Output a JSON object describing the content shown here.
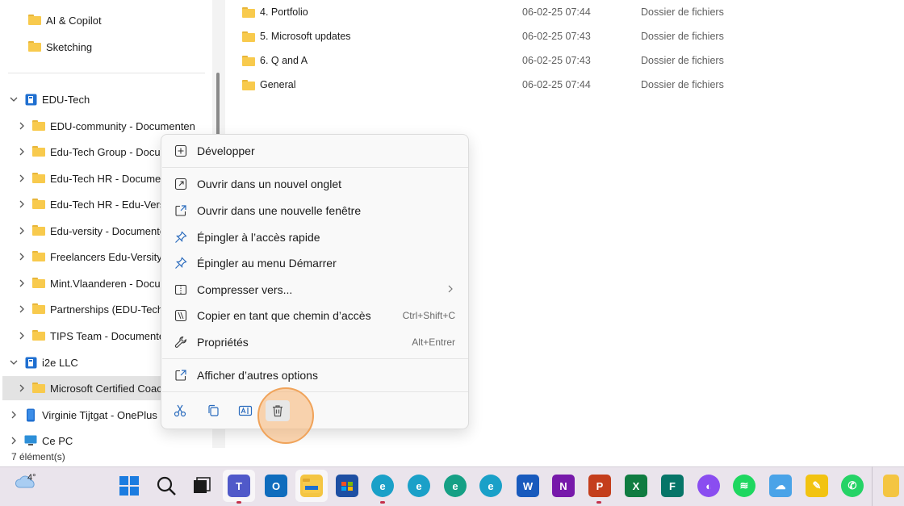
{
  "sidebar": {
    "top_items": [
      {
        "label": "AI & Copilot"
      },
      {
        "label": "Sketching"
      }
    ],
    "edu_tech": {
      "label": "EDU-Tech"
    },
    "edu_tech_children": [
      {
        "label": "EDU-community - Documenten"
      },
      {
        "label": "Edu-Tech Group - Docum"
      },
      {
        "label": "Edu-Tech HR - Document"
      },
      {
        "label": "Edu-Tech HR - Edu-Versit"
      },
      {
        "label": "Edu-versity - Documente"
      },
      {
        "label": "Freelancers Edu-Versity -"
      },
      {
        "label": "Mint.Vlaanderen - Docum"
      },
      {
        "label": "Partnerships (EDU-Tech)-"
      },
      {
        "label": "TIPS Team - Documenten"
      }
    ],
    "i2e": {
      "label": "i2e LLC"
    },
    "i2e_child": {
      "label": "Microsoft Certified Coach"
    },
    "phone": {
      "label": "Virginie Tijtgat - OnePlus N"
    },
    "pc": {
      "label": "Ce PC"
    }
  },
  "files": [
    {
      "name": "4. Portfolio",
      "date": "06-02-25 07:44",
      "type": "Dossier de fichiers"
    },
    {
      "name": "5. Microsoft updates",
      "date": "06-02-25 07:43",
      "type": "Dossier de fichiers"
    },
    {
      "name": "6. Q and A",
      "date": "06-02-25 07:43",
      "type": "Dossier de fichiers"
    },
    {
      "name": "General",
      "date": "06-02-25 07:44",
      "type": "Dossier de fichiers"
    }
  ],
  "status": {
    "count": "7 élément(s)"
  },
  "context_menu": {
    "expand": "Développer",
    "open_new_tab": "Ouvrir dans un nouvel onglet",
    "open_new_window": "Ouvrir dans une nouvelle fenêtre",
    "pin_quick_access": "Épingler à l’accès rapide",
    "pin_start": "Épingler au menu Démarrer",
    "compress": "Compresser vers...",
    "copy_path": "Copier en tant que chemin d’accès",
    "copy_path_shortcut": "Ctrl+Shift+C",
    "properties": "Propriétés",
    "properties_shortcut": "Alt+Entrer",
    "more_options": "Afficher d’autres options"
  },
  "taskbar": {
    "weather_temp": "4°"
  },
  "colors": {
    "accent": "#2a6bbd",
    "folder": "#f8ca4d",
    "highlight": "#f0a35a",
    "taskbar": "#eae4ec"
  }
}
